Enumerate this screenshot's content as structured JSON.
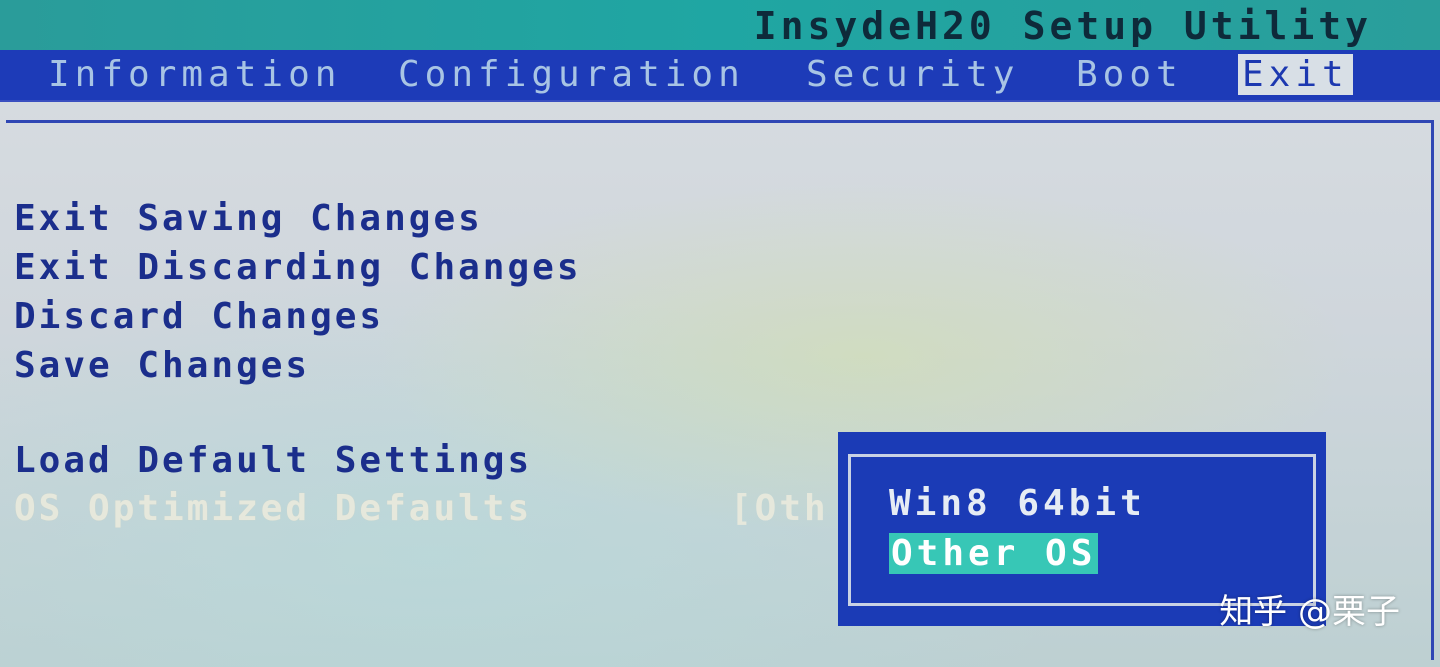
{
  "window": {
    "title": "InsydeH20 Setup Utility"
  },
  "menu": {
    "items": [
      {
        "label": "Information"
      },
      {
        "label": "Configuration"
      },
      {
        "label": "Security"
      },
      {
        "label": "Boot"
      },
      {
        "label": "Exit",
        "active": true
      }
    ]
  },
  "exit_options": {
    "items": [
      {
        "label": "Exit Saving Changes"
      },
      {
        "label": "Exit Discarding Changes"
      },
      {
        "label": "Discard Changes"
      },
      {
        "label": "Save Changes"
      },
      {
        "label": "Load Default Settings"
      },
      {
        "label": "OS Optimized Defaults",
        "value": "[Oth"
      }
    ]
  },
  "popup": {
    "options": [
      {
        "label": "Win8 64bit"
      },
      {
        "label": "Other OS",
        "selected": true
      }
    ]
  },
  "watermark": {
    "text": "知乎 @栗子"
  },
  "colors": {
    "title_bar": "#1fa6a3",
    "menu_bar": "#1d3bb8",
    "option_text": "#1b2e8c",
    "popup_bg": "#1b3bb6",
    "popup_selected": "#37c7b6"
  }
}
